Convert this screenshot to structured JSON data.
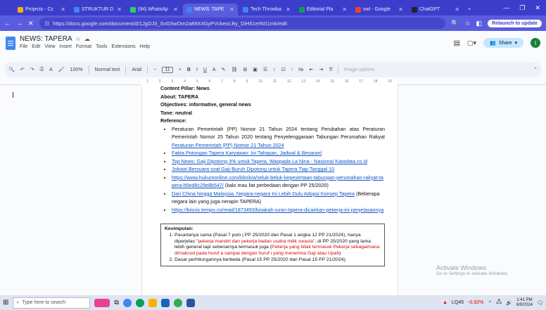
{
  "browser": {
    "tabs": [
      {
        "label": "Projects - Cc",
        "color": "#f4b400",
        "active": false
      },
      {
        "label": "STRUKTUR D",
        "color": "#4285f4",
        "active": false
      },
      {
        "label": "(94) WhatsAp",
        "color": "#25d366",
        "active": false
      },
      {
        "label": "NEWS: TAPE",
        "color": "#4285f4",
        "active": true
      },
      {
        "label": "Tech Throwba",
        "color": "#4285f4",
        "active": false
      },
      {
        "label": "Editorial Pla",
        "color": "#0f9d58",
        "active": false
      },
      {
        "label": "swl - Google",
        "color": "#ea4335",
        "active": false
      },
      {
        "label": "ChatGPT",
        "color": "#222222",
        "active": false
      }
    ],
    "url": "https://docs.google.com/document/d/1JgDJ3_SvG5wOm2a89X4GyPVckeoLBy_DiH51eINS1mk/edit",
    "relaunch": "Relaunch to update"
  },
  "doc": {
    "title": "NEWS: TAPERA",
    "menus": [
      "File",
      "Edit",
      "View",
      "Insert",
      "Format",
      "Tools",
      "Extensions",
      "Help"
    ],
    "share": "Share",
    "avatar": "I"
  },
  "toolbar": {
    "zoom": "100%",
    "style": "Normal text",
    "font": "Arial",
    "size": "11",
    "image_options": "Image options"
  },
  "ruler": [
    "1",
    "2",
    "3",
    "4",
    "5",
    "6",
    "7",
    "8",
    "9",
    "10",
    "11",
    "12",
    "13",
    "14",
    "15",
    "16",
    "17",
    "18",
    "19"
  ],
  "content": {
    "pillar": "Content Pillar: News",
    "about": "About: TAPERA",
    "objectives": "Objectives: informative, general news",
    "tone": "Tone: neutral",
    "reference": "Reference:",
    "ref1_text": "Peraturan Pemerintah (PP) Nomor 21 Tahun 2024 tentang Perubahan atas Peraturan Pemerintah Nomor 25 Tahun 2020 tentang Penyelenggaraan Tabungan Perumahan Rakyat ",
    "ref1_link": "Peraturan Pemerintah (PP) Nomor 21 Tahun 2024",
    "ref2": "Fakta Potongan Tapera Karyawan: Ini Tahapan, Jadwal & Besaranl",
    "ref3": "Top News: Gaji Dipotong 3% untuk Tapera, Waspada La Nina - Nasional Katadata.co.id",
    "ref4": "Jokowi Bersuara soal Gaji Buruh Dipotong untuk Tapera Tiap Tanggal 10",
    "ref5_link": "https://www.hukumonline.com/klinik/a/seluk-beluk-kepesertaan-tabungan-perumahan-rakyat-tapera-lt5ed8c29e8b547/",
    "ref5_note": " (kalo mau liat perbedaan dengan PP 25/2020)",
    "ref6_link": "Dari China hingga Malaysia, Negara-negara Ini Lebih Dulu Adopsi Konsep Tapera",
    "ref6_note": " (Beberapa negara lain yang juga nerapin TAPERA)",
    "ref7_link": "https://bisnis.tempo.co/read/1873493/bisakah-iuran-tapera-dicairkan-pekerja-ini-penjelasannya",
    "kesimpulan": "Kesimpulan:",
    "k1_a": "Pasartanya sama (Pasal 7 poin j PP 25/2020 dan Pasal 1 angka 12 PP 21/2024), hanya diperjelas ",
    "k1_red1": "\"pekerja mandiri dan pekerja badan usaha milik swasta\"",
    "k1_b": ", di PP 25/2020 yang lama lebih general tapi sebenarnya termasuk juga (",
    "k1_red2": "Pekerja yang tidak termasuk Pekerja sebagaimana dimaksud pada huruf a sampai dengan huruf i yang menerima Gaji atau Upah",
    "k1_c": ")",
    "k2": "Dasar perhitungannya berbeda (Pasal 15 PP 25/2020 dan Pasal 15 PP 21/2024)."
  },
  "watermark": {
    "title": "Activate Windows",
    "sub": "Go to Settings to activate Windows."
  },
  "taskbar": {
    "search": "Type here to search",
    "stock": "LQ45",
    "change": "-0,92%",
    "time": "1:41 PM",
    "date": "6/9/2024"
  }
}
